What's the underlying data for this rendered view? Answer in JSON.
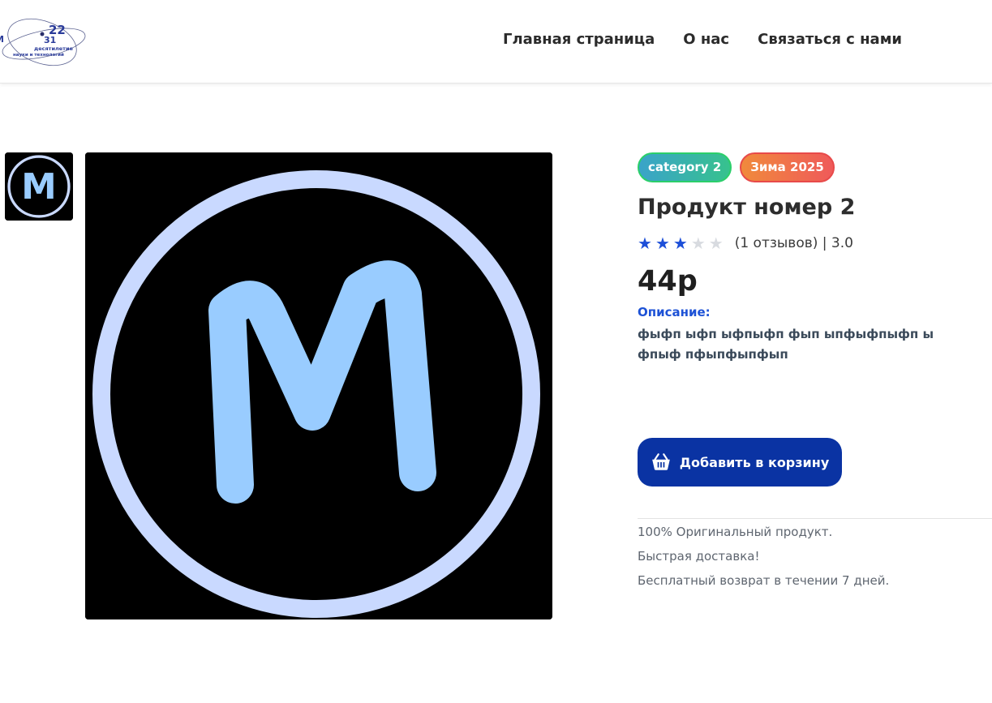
{
  "header": {
    "logo": {
      "numbers": [
        "22",
        "31"
      ],
      "text_line1": "десятилетие",
      "text_line2": "науки и технологий",
      "left_letter": "М"
    },
    "nav": [
      {
        "label": "Главная страница"
      },
      {
        "label": "О нас"
      },
      {
        "label": "Связаться с нами"
      }
    ]
  },
  "gallery": {
    "thumbnail_letter": "M",
    "main_letter": "M"
  },
  "product": {
    "badges": [
      {
        "label": "category 2"
      },
      {
        "label": "Зима 2025"
      }
    ],
    "title": "Продукт номер 2",
    "rating_value": 3,
    "rating_max": 5,
    "reviews_text": "(1 отзывов) | 3.0",
    "price": "44р",
    "description_label": "Описание:",
    "description": "фыфп ыфп ыфпыфп фып ыпфыфпыфп ы фпыф пфыпфыпфып",
    "add_to_cart_label": "Добавить в корзину",
    "features": [
      "100% Оригинальный продукт.",
      "Быстрая доставка!",
      "Бесплатный возврат в течении 7 дней."
    ]
  },
  "colors": {
    "accent_blue": "#1d4fd8",
    "button_blue": "#0a33a3",
    "logo_ring": "#c9d9ff",
    "logo_letter": "#99ccff"
  },
  "icons": {
    "cart": "shopping-basket-icon",
    "star": "star-icon"
  }
}
